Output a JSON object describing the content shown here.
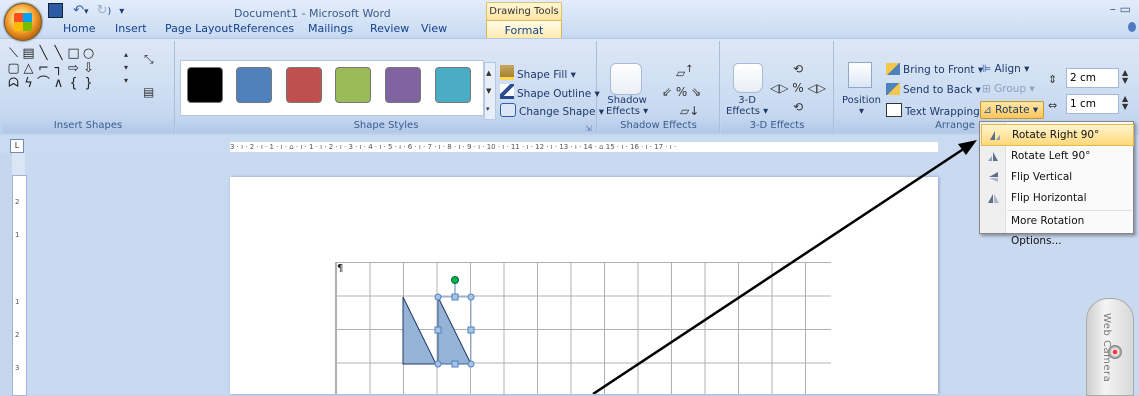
{
  "title_bar": {
    "document_title": "Document1 - Microsoft Word",
    "contextual_tab": "Drawing Tools",
    "window_controls": "–  ▭"
  },
  "tabs": [
    "Home",
    "Insert",
    "Page Layout",
    "References",
    "Mailings",
    "Review",
    "View",
    "Format"
  ],
  "active_tab": "Format",
  "ribbon": {
    "groups": {
      "insert_shapes": "Insert Shapes",
      "shape_styles": "Shape Styles",
      "shadow_effects": "Shadow Effects",
      "three_d_effects": "3-D Effects",
      "arrange": "Arrange"
    },
    "shape_fill": "Shape Fill",
    "shape_outline": "Shape Outline",
    "change_shape": "Change Shape",
    "shadow_effects_btn": [
      "Shadow",
      "Effects"
    ],
    "three_d_btn": [
      "3-D",
      "Effects"
    ],
    "bring_to_front": "Bring to Front",
    "send_to_back": "Send to Back",
    "text_wrapping": "Text Wrapping",
    "align": "Align",
    "group": "Group",
    "rotate": "Rotate",
    "position": "Position",
    "height_value": "2 cm",
    "width_value": "1 cm",
    "style_swatches": [
      "#000000",
      "#4f81bd",
      "#c0504d",
      "#9bbb59",
      "#8064a2",
      "#4bacc6"
    ]
  },
  "ruler": {
    "horizontal": "3 · ı · 2 · ı · 1 · ı · ⌂ · ı · 1 · ı · 2 · ı · 3 · ı · 4 · ı · 5 · ı · 6 · ı · 7 · ı · 8 · ı · 9 · ı · 10 · ı · 11 · ı · 12 · ı · 13 · ı · 14 · ⌂ 15 · ı · 16 · ı · 17 · ı ·",
    "vertical_marks": [
      "2",
      "1",
      "1",
      "2",
      "3"
    ]
  },
  "rotate_menu": {
    "items": [
      {
        "label": "Rotate Right 90°",
        "hover": true
      },
      {
        "label": "Rotate Left 90°",
        "hover": false
      },
      {
        "label": "Flip Vertical",
        "hover": false
      },
      {
        "label": "Flip Horizontal",
        "hover": false
      },
      {
        "label": "More Rotation Options...",
        "hover": false
      }
    ]
  },
  "webcam_label": "Web Camera",
  "colors": {
    "accent_orange": "#ffd97a",
    "shape_fill": "#95b3d7",
    "shape_stroke": "#1f3864",
    "selection_handle": "#4f81bd",
    "rotation_handle": "#00b050"
  }
}
